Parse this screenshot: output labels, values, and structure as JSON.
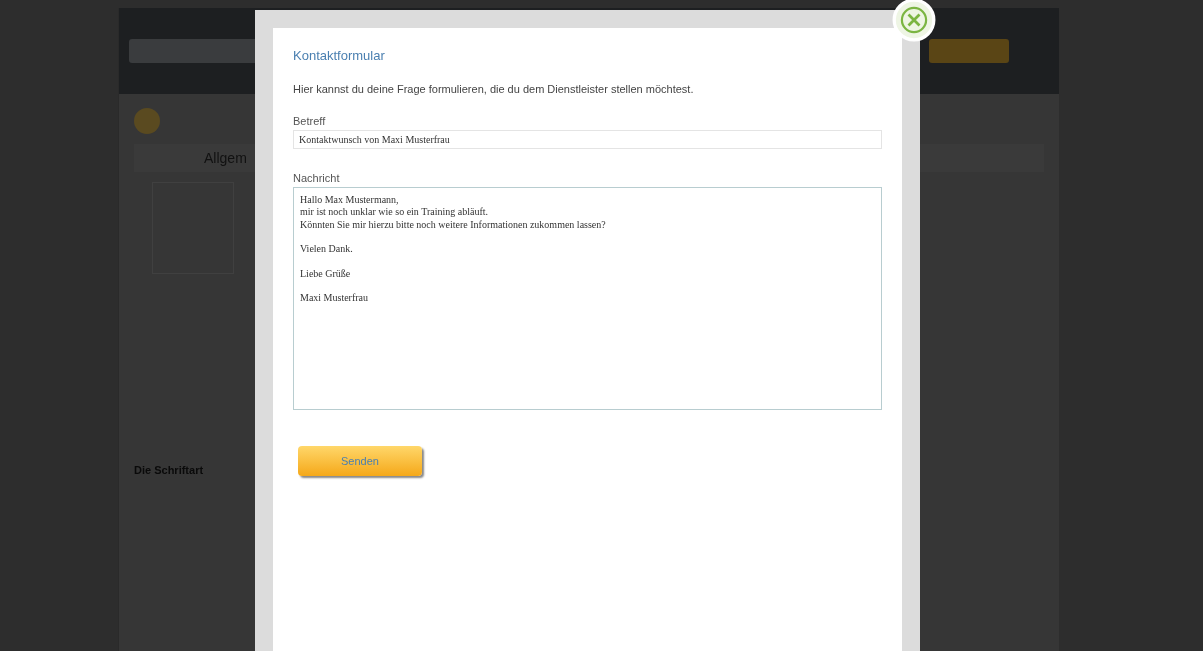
{
  "background": {
    "tab_label": "Allgem",
    "heading": "Die Schriftart"
  },
  "dialog": {
    "title": "Kontaktformular",
    "intro": "Hier kannst du deine Frage formulieren, die du dem Dienstleister stellen möchtest.",
    "fields": [
      {
        "kind": "input",
        "label": "Betreff",
        "value": "Kontaktwunsch von Maxi Musterfrau"
      },
      {
        "kind": "textarea",
        "label": "Nachricht",
        "value": "Hallo Max Mustermann,\nmir ist noch unklar wie so ein Training abläuft.\nKönnten Sie mir hierzu bitte noch weitere Informationen zukommen lassen?\n\nVielen Dank.\n\nLiebe Grüße\n\nMaxi Musterfrau"
      }
    ],
    "submit": "Senden"
  }
}
